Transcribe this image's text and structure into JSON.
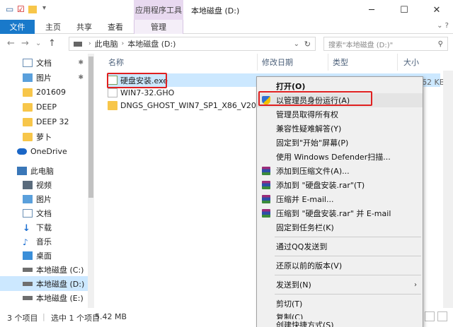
{
  "window": {
    "context_tab": "应用程序工具",
    "title": "本地磁盘 (D:)",
    "minimize": "─",
    "maximize": "☐",
    "close": "✕"
  },
  "ribbon": {
    "tabs": [
      "文件",
      "主页",
      "共享",
      "查看",
      "管理"
    ],
    "help_icon": "chevron-down-icon"
  },
  "address": {
    "path": [
      "此电脑",
      "本地磁盘 (D:)"
    ],
    "search_placeholder": "搜索\"本地磁盘 (D:)\""
  },
  "sidebar": {
    "items": [
      {
        "label": "文档",
        "icon": "doc-icon",
        "pinned": true
      },
      {
        "label": "图片",
        "icon": "pictures-icon",
        "pinned": true
      },
      {
        "label": "201609",
        "icon": "folder-icon"
      },
      {
        "label": "DEEP",
        "icon": "folder-icon"
      },
      {
        "label": "DEEP 32",
        "icon": "folder-icon"
      },
      {
        "label": "萝卜",
        "icon": "folder-icon"
      },
      {
        "label": "OneDrive",
        "icon": "cloud-icon"
      },
      {
        "label": "此电脑",
        "icon": "pc-icon"
      },
      {
        "label": "视频",
        "icon": "video-icon"
      },
      {
        "label": "图片",
        "icon": "pictures-icon"
      },
      {
        "label": "文档",
        "icon": "doc-icon"
      },
      {
        "label": "下载",
        "icon": "download-icon"
      },
      {
        "label": "音乐",
        "icon": "music-icon"
      },
      {
        "label": "桌面",
        "icon": "desktop-icon"
      },
      {
        "label": "本地磁盘 (C:)",
        "icon": "drive-icon"
      },
      {
        "label": "本地磁盘 (D:)",
        "icon": "drive-icon",
        "selected": true
      },
      {
        "label": "本地磁盘 (E:)",
        "icon": "drive-icon"
      }
    ]
  },
  "columns": {
    "name": "名称",
    "modified": "修改日期",
    "type": "类型",
    "size": "大小"
  },
  "files": [
    {
      "name": "硬盘安装.exe",
      "icon": "exe-icon",
      "selected": true,
      "size_tail": "62 KB"
    },
    {
      "name": "WIN7-32.GHO",
      "icon": "gho-icon"
    },
    {
      "name": "DNGS_GHOST_WIN7_SP1_X86_V2016...",
      "icon": "folder-icon"
    }
  ],
  "status": {
    "count": "3 个项目",
    "selected": "选中 1 个项目",
    "size": "5.42 MB"
  },
  "context_menu": [
    {
      "label": "打开(O)",
      "bold": true
    },
    {
      "label": "以管理员身份运行(A)",
      "icon": "shield-icon",
      "highlighted": true
    },
    {
      "label": "管理员取得所有权"
    },
    {
      "label": "兼容性疑难解答(Y)"
    },
    {
      "label": "固定到\"开始\"屏幕(P)"
    },
    {
      "label": "使用 Windows Defender扫描..."
    },
    {
      "label": "添加到压缩文件(A)...",
      "icon": "winrar-icon"
    },
    {
      "label": "添加到 \"硬盘安装.rar\"(T)",
      "icon": "winrar-icon"
    },
    {
      "label": "压缩并 E-mail...",
      "icon": "winrar-icon"
    },
    {
      "label": "压缩到 \"硬盘安装.rar\" 并 E-mail",
      "icon": "winrar-icon"
    },
    {
      "label": "固定到任务栏(K)"
    },
    {
      "label": "通过QQ发送到",
      "separator_before": true
    },
    {
      "label": "还原以前的版本(V)",
      "separator_before": true
    },
    {
      "label": "发送到(N)",
      "separator_before": true,
      "submenu": true
    },
    {
      "label": "剪切(T)",
      "separator_before": true
    },
    {
      "label": "复制(C)"
    },
    {
      "label": "创建快捷方式(S)",
      "separator_before": true
    }
  ]
}
